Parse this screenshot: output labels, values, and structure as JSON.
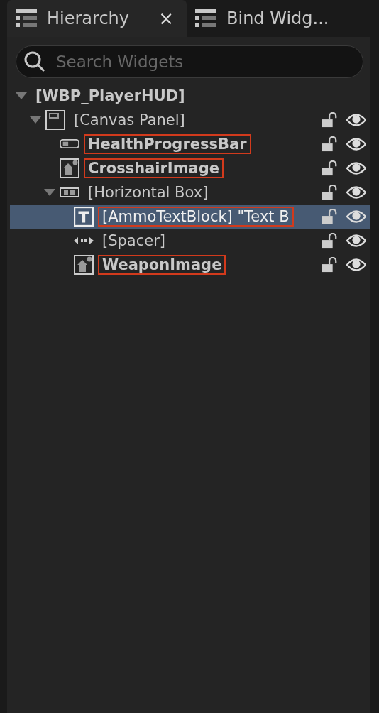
{
  "tabs": [
    {
      "label": "Hierarchy",
      "selected": true,
      "close_icon": "×"
    },
    {
      "label": "Bind Widg...",
      "selected": false
    }
  ],
  "search": {
    "placeholder": "Search Widgets"
  },
  "tree": [
    {
      "label": "[WBP_PlayerHUD]",
      "kind": "blueprint",
      "is_variable": true,
      "expanded": true,
      "selected": false,
      "highlighted": false,
      "children": [
        {
          "label": "[Canvas Panel]",
          "kind": "canvas_panel",
          "is_variable": false,
          "expanded": true,
          "selected": false,
          "highlighted": false,
          "locked": false,
          "visible": true,
          "children": [
            {
              "label": "HealthProgressBar",
              "kind": "progress_bar",
              "is_variable": true,
              "selected": false,
              "highlighted": true,
              "locked": false,
              "visible": true
            },
            {
              "label": "CrosshairImage",
              "kind": "image",
              "is_variable": true,
              "selected": false,
              "highlighted": true,
              "locked": false,
              "visible": true
            },
            {
              "label": "[Horizontal Box]",
              "kind": "horizontal_box",
              "is_variable": false,
              "expanded": true,
              "selected": false,
              "highlighted": false,
              "locked": false,
              "visible": true,
              "children": [
                {
                  "label": "[AmmoTextBlock] \"Text B",
                  "kind": "text_block",
                  "is_variable": false,
                  "selected": true,
                  "highlighted": true,
                  "locked": false,
                  "visible": true
                },
                {
                  "label": "[Spacer]",
                  "kind": "spacer",
                  "is_variable": false,
                  "selected": false,
                  "highlighted": false,
                  "locked": false,
                  "visible": true
                },
                {
                  "label": "WeaponImage",
                  "kind": "image",
                  "is_variable": true,
                  "selected": false,
                  "highlighted": true,
                  "locked": false,
                  "visible": true
                }
              ]
            }
          ]
        }
      ]
    }
  ]
}
